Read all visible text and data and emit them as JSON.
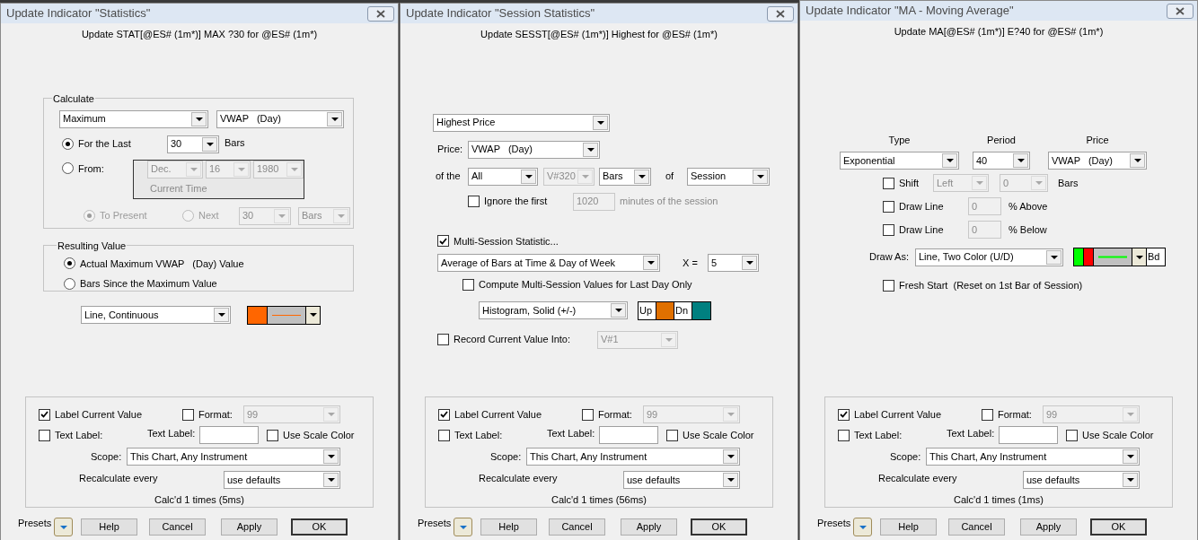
{
  "dialogs": [
    {
      "kind": "statistics",
      "title": "Update Indicator \"Statistics\"",
      "subtitle": "Update STAT[@ES# (1m*)] MAX ?30 for @ES# (1m*)",
      "calculate": {
        "legend": "Calculate",
        "statistic": {
          "value": "Maximum"
        },
        "price": {
          "value": "VWAP   (Day)"
        },
        "for_last": {
          "label": "For the Last",
          "selected": true
        },
        "count": {
          "value": "30"
        },
        "count_unit": "Bars",
        "from": {
          "label": "From:",
          "selected": false
        },
        "month": {
          "value": "Dec.",
          "disabled": true
        },
        "day": {
          "value": "16",
          "disabled": true
        },
        "year": {
          "value": "1980",
          "disabled": true
        },
        "current_time": "Current Time",
        "to_present": {
          "label": "To Present",
          "selected": true,
          "disabled": true
        },
        "next": {
          "label": "Next",
          "selected": false,
          "disabled": true
        },
        "next_count": {
          "value": "30",
          "disabled": true
        },
        "next_unit": {
          "value": "Bars",
          "disabled": true
        }
      },
      "result": {
        "legend": "Resulting Value",
        "options": [
          {
            "label": "Actual Maximum VWAP   (Day) Value",
            "selected": true
          },
          {
            "label": "Bars Since the Maximum Value",
            "selected": false
          }
        ]
      },
      "draw_as": {
        "value": "Line, Continuous"
      },
      "style": {
        "swatches": [
          {
            "color": "#ff6600"
          }
        ],
        "line": {
          "color": "#ff6600"
        }
      },
      "footer": {
        "label_value": {
          "label": "Label Current Value",
          "checked": true
        },
        "format": {
          "label": "Format:",
          "checked": false
        },
        "format_value": {
          "value": "99",
          "disabled": true
        },
        "text_label": {
          "label": "Text Label:",
          "checked": false
        },
        "text_label_caption": "Text Label:",
        "use_scale": {
          "label": "Use Scale Color",
          "checked": false
        },
        "scope_label": "Scope:",
        "scope": {
          "value": "This Chart, Any Instrument"
        },
        "recalc_label": "Recalculate every",
        "recalc": {
          "value": "use defaults"
        },
        "calcd": "Calc'd 1 times (5ms)"
      },
      "presets": "Presets",
      "buttons": [
        {
          "label": "Help",
          "default": false
        },
        {
          "label": "Cancel",
          "default": false
        },
        {
          "label": "Apply",
          "default": false
        },
        {
          "label": "OK",
          "default": true
        }
      ]
    },
    {
      "kind": "session",
      "title": "Update Indicator \"Session Statistics\"",
      "subtitle": "Update SESST[@ES# (1m*)] Highest for @ES# (1m*)",
      "stat": {
        "value": "Highest Price"
      },
      "price_label": "Price:",
      "price": {
        "value": "VWAP   (Day)"
      },
      "of_the_label": "of the",
      "range": {
        "value": "All"
      },
      "bar_var": {
        "value": "V#320",
        "disabled": true
      },
      "unit": {
        "value": "Bars"
      },
      "of_label": "of",
      "period": {
        "value": "Session"
      },
      "ignore": {
        "label": "Ignore the first",
        "checked": false
      },
      "ignore_minutes": {
        "value": "1020",
        "disabled": true
      },
      "ignore_suffix": "minutes of the session",
      "multi": {
        "label": "Multi-Session Statistic...",
        "checked": true
      },
      "multi_type": {
        "value": "Average of Bars at Time & Day of Week"
      },
      "x_label": "X =",
      "x": {
        "value": "5"
      },
      "last_day": {
        "label": "Compute Multi-Session Values for Last Day Only",
        "checked": false
      },
      "draw_as": {
        "value": "Histogram, Solid (+/-)"
      },
      "swatches": [
        {
          "label": "Up",
          "color": "#e07000"
        },
        {
          "label": "Dn",
          "color": "#008080"
        }
      ],
      "record": {
        "label": "Record Current Value Into:",
        "checked": false
      },
      "record_var": {
        "value": "V#1",
        "disabled": true
      },
      "footer": {
        "label_value": {
          "label": "Label Current Value",
          "checked": true
        },
        "format": {
          "label": "Format:",
          "checked": false
        },
        "format_value": {
          "value": "99",
          "disabled": true
        },
        "text_label": {
          "label": "Text Label:",
          "checked": false
        },
        "text_label_caption": "Text Label:",
        "use_scale": {
          "label": "Use Scale Color",
          "checked": false
        },
        "scope_label": "Scope:",
        "scope": {
          "value": "This Chart, Any Instrument"
        },
        "recalc_label": "Recalculate every",
        "recalc": {
          "value": "use defaults"
        },
        "calcd": "Calc'd 1 times (56ms)"
      },
      "presets": "Presets",
      "buttons": [
        {
          "label": "Help",
          "default": false
        },
        {
          "label": "Cancel",
          "default": false
        },
        {
          "label": "Apply",
          "default": false
        },
        {
          "label": "OK",
          "default": true
        }
      ]
    },
    {
      "kind": "moving_average",
      "title": "Update Indicator \"MA - Moving Average\"",
      "subtitle": "Update MA[@ES# (1m*)] E?40 for @ES# (1m*)",
      "columns": [
        {
          "label": "Type",
          "combo": {
            "value": "Exponential"
          }
        },
        {
          "label": "Period",
          "combo": {
            "value": "40"
          }
        },
        {
          "label": "Price",
          "combo": {
            "value": "VWAP   (Day)"
          }
        }
      ],
      "shift": {
        "label": "Shift",
        "checked": false
      },
      "shift_dir": {
        "value": "Left",
        "disabled": true
      },
      "shift_bars": {
        "value": "0",
        "disabled": true
      },
      "shift_unit": "Bars",
      "lines": [
        {
          "label": "Draw Line",
          "checked": false,
          "value": "0",
          "suffix": "% Above"
        },
        {
          "label": "Draw Line",
          "checked": false,
          "value": "0",
          "suffix": "% Below"
        }
      ],
      "draw_as_label": "Draw As:",
      "draw_as": {
        "value": "Line, Two Color (U/D)"
      },
      "style": {
        "swatches": [
          {
            "color": "#00ff00"
          },
          {
            "color": "#ff0000"
          }
        ],
        "line": {
          "color": "#00ff00"
        },
        "bold": "Bd"
      },
      "fresh_start": {
        "label": "Fresh Start  (Reset on 1st Bar of Session)",
        "checked": false
      },
      "footer": {
        "label_value": {
          "label": "Label Current Value",
          "checked": true
        },
        "format": {
          "label": "Format:",
          "checked": false
        },
        "format_value": {
          "value": "99",
          "disabled": true
        },
        "text_label": {
          "label": "Text Label:",
          "checked": false
        },
        "text_label_caption": "Text Label:",
        "use_scale": {
          "label": "Use Scale Color",
          "checked": false
        },
        "scope_label": "Scope:",
        "scope": {
          "value": "This Chart, Any Instrument"
        },
        "recalc_label": "Recalculate every",
        "recalc": {
          "value": "use defaults"
        },
        "calcd": "Calc'd 1 times (1ms)"
      },
      "presets": "Presets",
      "buttons": [
        {
          "label": "Help",
          "default": false
        },
        {
          "label": "Cancel",
          "default": false
        },
        {
          "label": "Apply",
          "default": false
        },
        {
          "label": "OK",
          "default": true
        }
      ]
    }
  ]
}
